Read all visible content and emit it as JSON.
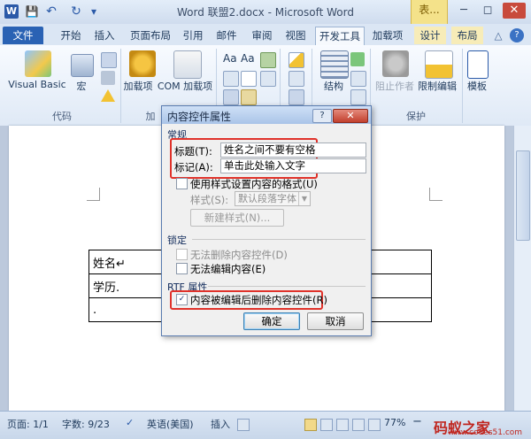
{
  "window": {
    "title": "Word 联盟2.docx - Microsoft Word",
    "context_tab": "表...",
    "minimize": "─",
    "restore": "◻",
    "close": "✕"
  },
  "quick_access": {
    "app_icon": "W",
    "save_icon": "💾",
    "undo_icon": "↶",
    "redo_icon": "↻",
    "more_icon": "▾"
  },
  "tabs": [
    {
      "label": "文件"
    },
    {
      "label": "开始"
    },
    {
      "label": "插入"
    },
    {
      "label": "页面布局"
    },
    {
      "label": "引用"
    },
    {
      "label": "邮件"
    },
    {
      "label": "审阅"
    },
    {
      "label": "视图"
    },
    {
      "label": "开发工具"
    },
    {
      "label": "加载项"
    },
    {
      "label": "设计"
    },
    {
      "label": "布局"
    }
  ],
  "ribbon_right_icons": {
    "minimize_ribbon": "△",
    "help": "?"
  },
  "ribbon": {
    "code_group": {
      "label": "代码",
      "visual_basic": "Visual Basic",
      "macro": "宏"
    },
    "addins_group": {
      "label": "加",
      "addins": "加载项",
      "com_addins": "COM 加载项"
    },
    "xml_group": {
      "structure": "结构"
    },
    "protect_group": {
      "label": "保护",
      "block_authors": "阻止作者",
      "restrict_editing": "限制编辑"
    },
    "templates_group": {
      "template": "模板"
    }
  },
  "document": {
    "table": [
      [
        "姓名↵",
        ""
      ],
      [
        "学历.",
        ""
      ],
      [
        ".",
        ""
      ]
    ]
  },
  "dialog": {
    "title": "内容控件属性",
    "help": "?",
    "close": "✕",
    "general_section": "常规",
    "title_label": "标题(T):",
    "title_value": "姓名之间不要有空格",
    "tag_label": "标记(A):",
    "tag_value": "单击此处输入文字",
    "use_style_label": "使用样式设置内容的格式(U)",
    "style_label": "样式(S):",
    "style_value": "默认段落字体",
    "new_style_button": "新建样式(N)...",
    "locking_section": "锁定",
    "cannot_delete_label": "无法删除内容控件(D)",
    "cannot_edit_label": "无法编辑内容(E)",
    "rtf_section": "RTF 属性",
    "remove_when_edited_label": "内容被编辑后删除内容控件(R)",
    "remove_checked": "✓",
    "ok_button": "确定",
    "cancel_button": "取消"
  },
  "statusbar": {
    "page": "页面: 1/1",
    "words": "字数: 9/23",
    "language": "英语(美国)",
    "insert_mode": "插入",
    "zoom": "77%",
    "zoom_minus": "−",
    "zoom_plus": "+"
  },
  "watermark": {
    "brand": "码蚁之家",
    "url": "www.codes51.com"
  }
}
